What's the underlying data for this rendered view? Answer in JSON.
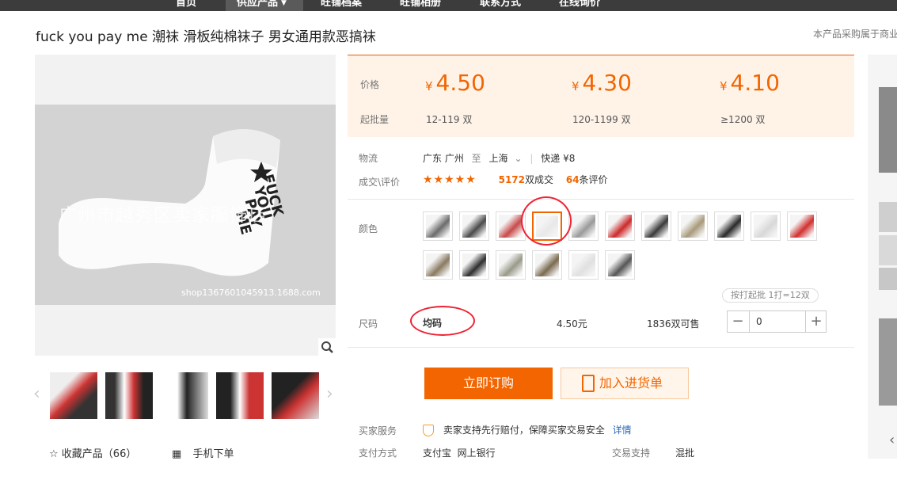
{
  "nav": {
    "items": [
      {
        "label": "首页"
      },
      {
        "label": "供应产品",
        "active": true
      },
      {
        "label": "旺铺档案"
      },
      {
        "label": "旺铺相册"
      },
      {
        "label": "联系方式"
      },
      {
        "label": "在线询价"
      }
    ]
  },
  "product": {
    "title": "fuck you pay me 潮袜 滑板纯棉袜子 男女通用款恶搞袜",
    "note": "本产品采购属于商业"
  },
  "gallery": {
    "watermark": "广州市越秀区卖家服饰店",
    "shop_url": "shop1367601045913.1688.com",
    "fav_label": "收藏产品（66）",
    "mobile_label": "手机下单"
  },
  "pricing": {
    "price_label": "价格",
    "moq_label": "起批量",
    "currency": "¥",
    "tiers": [
      {
        "price": "4.50",
        "range": "12-119 双"
      },
      {
        "price": "4.30",
        "range": "120-1199 双"
      },
      {
        "price": "4.10",
        "range": "≥1200 双"
      }
    ]
  },
  "logistics": {
    "label": "物流",
    "from": "广东 广州",
    "to_word": "至",
    "to": "上海",
    "express": "快递 ¥8"
  },
  "deals": {
    "label": "成交\\评价",
    "rating": 5,
    "sold_count": "5172",
    "sold_suffix": "双成交",
    "review_count": "64",
    "review_suffix": "条评价"
  },
  "color": {
    "label": "颜色",
    "swatches": [
      {
        "color": "#6b6b6b"
      },
      {
        "color": "#4a4a4a"
      },
      {
        "color": "#c84a4a"
      },
      {
        "color": "#e8e8e8",
        "selected": true
      },
      {
        "color": "#9a9a9a"
      },
      {
        "color": "#cc2a2a"
      },
      {
        "color": "#3a3a3a"
      },
      {
        "color": "#a89a7a"
      },
      {
        "color": "#2a2a2a"
      },
      {
        "color": "#d8d8d8"
      },
      {
        "color": "#d23030"
      },
      {
        "color": "#8a7a60"
      },
      {
        "color": "#2e2e2e"
      },
      {
        "color": "#9a9a8a"
      },
      {
        "color": "#7a6a50"
      },
      {
        "color": "#e0e0e0"
      },
      {
        "color": "#555555"
      }
    ]
  },
  "size": {
    "label": "尺码",
    "value": "均码",
    "price": "4.50元",
    "stock": "1836双可售",
    "batch_hint": "按打起批 1打=12双",
    "qty": "0",
    "minus": "−",
    "plus": "+"
  },
  "actions": {
    "buy_label": "立即订购",
    "cart_label": "加入进货单"
  },
  "service": {
    "buyer_label": "买家服务",
    "buyer_text": "卖家支持先行赔付，保障买家交易安全",
    "detail_link": "详情",
    "pay_label": "支付方式",
    "pay_methods": "支付宝  网上银行",
    "trade_label": "交易支持",
    "trade_value": "混批"
  },
  "colors": {
    "accent": "#f26500",
    "price_bg": "#fff3e8",
    "nav_bg": "#3c3c3c"
  }
}
